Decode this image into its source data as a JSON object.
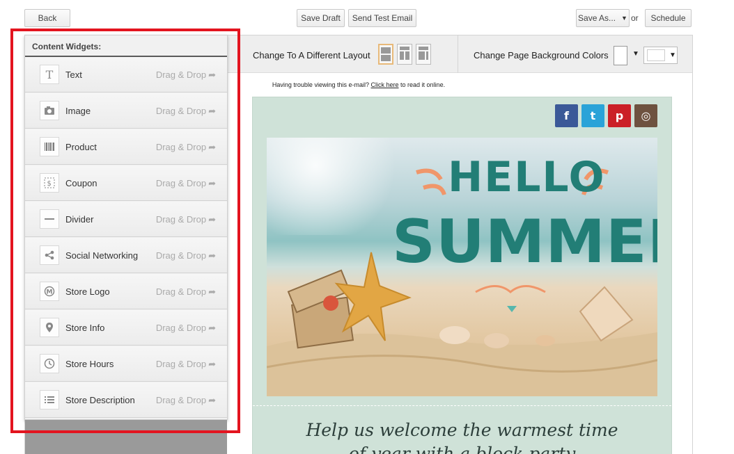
{
  "topbar": {
    "back_label": "Back",
    "save_draft_label": "Save Draft",
    "send_test_label": "Send Test Email",
    "save_as_label": "Save As...",
    "or_text": "or",
    "schedule_label": "Schedule"
  },
  "toolbar": {
    "layout_label": "Change To A Different Layout",
    "bg_label": "Change Page Background Colors"
  },
  "email": {
    "trouble_text": "Having trouble viewing this e-mail?",
    "trouble_link": "Click here",
    "trouble_suffix": "to read it online.",
    "social": [
      {
        "icon": "facebook-icon",
        "glyph": "f",
        "color": "#3b5998"
      },
      {
        "icon": "twitter-icon",
        "glyph": "t",
        "color": "#2aa3d8"
      },
      {
        "icon": "pinterest-icon",
        "glyph": "p",
        "color": "#cb2027"
      },
      {
        "icon": "instagram-icon",
        "glyph": "◎",
        "color": "#6e5240"
      }
    ],
    "hero_line1": "HELLO",
    "hero_line2": "SUMMER",
    "headline_line1": "Help us welcome the warmest time",
    "headline_line2": "of year with a block party"
  },
  "widgets_panel": {
    "title": "Content Widgets:",
    "drag_label": "Drag & Drop",
    "items": [
      {
        "label": "Text",
        "icon": "text-icon"
      },
      {
        "label": "Image",
        "icon": "camera-icon"
      },
      {
        "label": "Product",
        "icon": "barcode-icon"
      },
      {
        "label": "Coupon",
        "icon": "coupon-icon"
      },
      {
        "label": "Divider",
        "icon": "divider-icon"
      },
      {
        "label": "Social Networking",
        "icon": "share-icon"
      },
      {
        "label": "Store Logo",
        "icon": "logo-icon"
      },
      {
        "label": "Store Info",
        "icon": "location-pin-icon"
      },
      {
        "label": "Store Hours",
        "icon": "clock-icon"
      },
      {
        "label": "Store Description",
        "icon": "list-icon"
      }
    ]
  },
  "colors": {
    "highlight": "#e3141f",
    "email_bg": "#cfe2d8",
    "hero_text": "#227e76",
    "hero_accent": "#f0966a"
  }
}
